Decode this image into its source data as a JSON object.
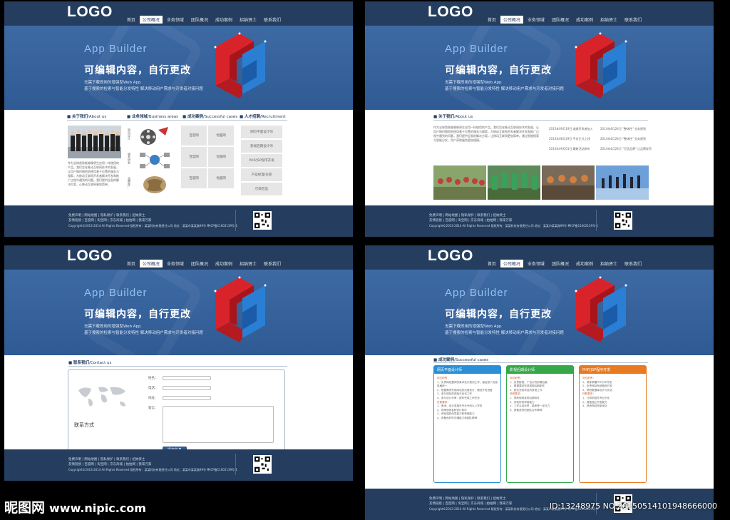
{
  "site": {
    "logo": "LOGO",
    "nav": [
      "首页",
      "公司概况",
      "业务领域",
      "团队概况",
      "成功案例",
      "招纳贤士",
      "联系我们"
    ],
    "banner_title": "App Builder",
    "banner_main": "可编辑内容，自行更改",
    "banner_sub1": "无需下载即用的增强型Web App",
    "banner_sub2": "基于搜索的检索与智能分发特性 解决移动用户需求与开发者对接问题",
    "footer_links1": "免费声明 | 网站地图 | 隐私保护 | 联系我们 | 招纳贤士",
    "footer_links2": "友情链接 | 百度网 | 淘宝网 | 京东商城 | 拍拍网 | 我来万家",
    "footer_copy": "Copyright©2013-2014 All Rights Reserved 版权所有：某某科技有限责任公司  地址：某某市某某路99号  粤ICP备11002139号-1"
  },
  "panel1": {
    "active_nav": 1,
    "sec_about": "关于我们",
    "sec_about_en": "/About us",
    "sec_business": "业务领域",
    "sec_business_en": "/Business areas",
    "sec_cases": "成功案例",
    "sec_cases_en": "/Successful cases",
    "sec_recruit": "人才招聘",
    "sec_recruit_en": "/Recruitment",
    "about_text": "作为全球首款能够像原生应用一样使用的产品。我们旨在推动互联网技术的发展，让用户随时随地地使用基于位置的服务与搜索，为移动互联网开发者解决开发和推广过程中遇到的问题。我们提供全面的解决方案，让移动互联网更加简单。",
    "business_labels": [
      "网页设计",
      "服务研发",
      "品牌推广"
    ],
    "case_cells": [
      "百度网",
      "优酷网",
      "百度网",
      "优酷网",
      "百度网",
      "优酷网"
    ],
    "recruit": [
      "网页平面设计师",
      "影视后期设计师",
      "PHP/JSP程序开发",
      "产品经理/主管",
      "行政后监"
    ]
  },
  "panel2": {
    "active_nav": 1,
    "sec_about": "关于我们",
    "sec_about_en": "/About us",
    "about_text": "作为全球首款能够像原生应用一样使用的产品。我们旨在推动互联网技术的发展，让用户随时随地地使用基于位置的服务与搜索，为移动互联网开发者解决开发和推广过程中遇到的问题，我们提供全面的解决方案，让移动互联网更加简单。通过智能搜索与智能分发，用户获取服务更加便捷。",
    "news": [
      {
        "date": "2013年09月19日",
        "title": "诚邀开发者加入"
      },
      {
        "date": "2013年08月29日",
        "title": "平台正式上线"
      },
      {
        "date": "2013年09月01日",
        "title": "最新活动发布"
      },
      {
        "date": "2014年4月24日",
        "title": "\"整体性\" 业务规划"
      },
      {
        "date": "2014年4月24日",
        "title": "\"整体性\" 业务规划"
      },
      {
        "date": "2014年4月24日",
        "title": "\"打造品牌\" 让品牌发声"
      }
    ]
  },
  "panel3": {
    "active_nav": 1,
    "sec_contact": "联系我们",
    "sec_contact_en": "/Contact us",
    "contact_title": "联系方式",
    "form_labels": [
      "姓名：",
      "电话：",
      "地址：",
      "留言："
    ],
    "submit_label": "提交信息"
  },
  "panel4": {
    "active_nav": 1,
    "sec_cases": "成功案例",
    "sec_cases_en": "/Successful cases",
    "columns": [
      {
        "title": "网页平面设计师",
        "color": "#2a8fd6",
        "req": "岗位职责：",
        "items": [
          "1、负责网站整体的美术设计规划工作，保证各个页面风格统一",
          "2、根据需求完成网站的页面设计，跟进开发进度",
          "3、参与网站的改版与优化工作",
          "4、参与设计评审，按时完成工作任务"
        ],
        "req2": "任职要求：",
        "items2": [
          "1、美术、设计或相关专业专科以上学历",
          "2、熟练使用各种设计软件",
          "3、有较强的创意能力和审美能力",
          "4、具备良好的沟通能力和团队精神"
        ]
      },
      {
        "title": "影视后期设计师",
        "color": "#35a84a",
        "req": "岗位职责：",
        "items": [
          "1、负责影视、广告片的剪辑包装",
          "2、根据要求完成视频后期制作",
          "3、配合完成项目的其他工作"
        ],
        "req2": "任职要求：",
        "items2": [
          "1、熟练使用各种后期软件",
          "2、有较好的审美能力",
          "3、工作认真负责，能承受一定压力",
          "4、具备良好的团队合作精神"
        ]
      },
      {
        "title": "PHP/JSP程序开发",
        "color": "#e87a22",
        "req": "岗位职责：",
        "items": [
          "1、熟练掌握PHP/JSP开发",
          "2、负责网站系统程序开发",
          "3、熟悉数据库设计与优化"
        ],
        "req2": "任职要求：",
        "items2": [
          "1、计算机相关专业毕业",
          "2、具备独立开发能力",
          "3、熟悉网站构架优化"
        ]
      }
    ]
  },
  "watermark": {
    "brand": "昵图网",
    "url": "www.nipic.com",
    "id": "ID:13248975 NO:20150514101948666000"
  }
}
